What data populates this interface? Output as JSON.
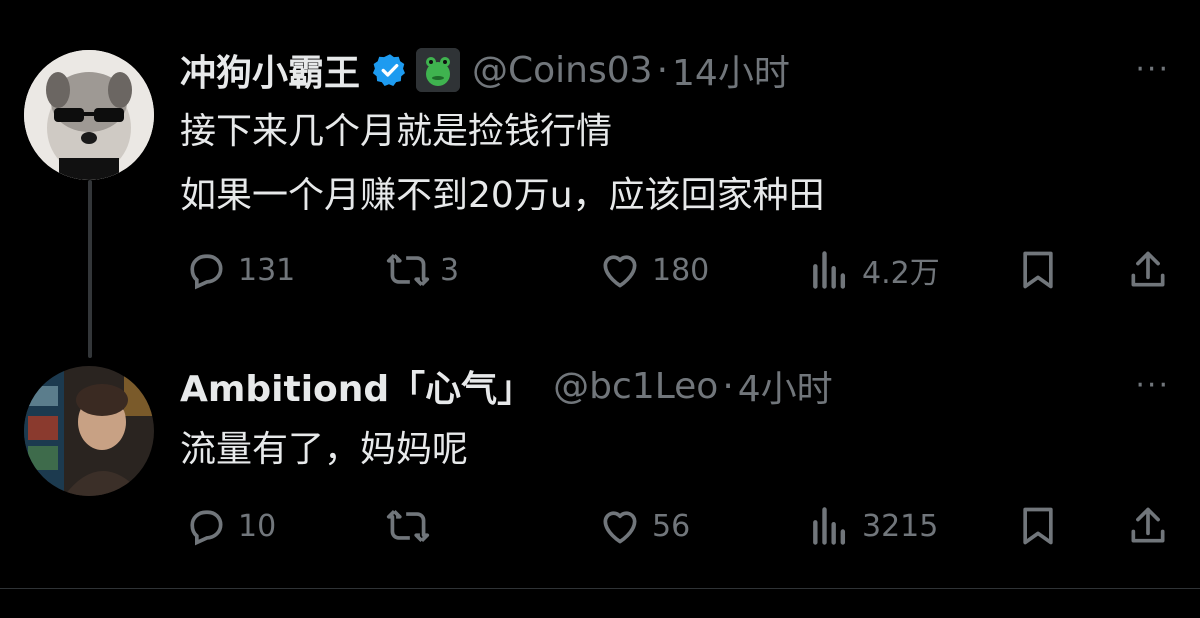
{
  "tweets": [
    {
      "author_name": "冲狗小霸王",
      "handle": "@Coins03",
      "separator": "·",
      "time": "14小时",
      "verified": true,
      "emoji_badge": "frog-emoji",
      "lines": [
        "接下来几个月就是捡钱行情",
        "如果一个月赚不到20万u，应该回家种田"
      ],
      "more": "···",
      "replies": "131",
      "retweets": "3",
      "likes": "180",
      "views": "4.2万"
    },
    {
      "author_name": "Ambitiond「心气」",
      "handle": "@bc1Leo",
      "separator": "·",
      "time": "4小时",
      "verified": false,
      "lines": [
        "流量有了，妈妈呢"
      ],
      "more": "···",
      "replies": "10",
      "retweets": "",
      "likes": "56",
      "views": "3215"
    }
  ],
  "colors": {
    "background": "#000000",
    "text": "#e7e9ea",
    "muted": "#71767b",
    "verified": "#1d9bf0"
  }
}
